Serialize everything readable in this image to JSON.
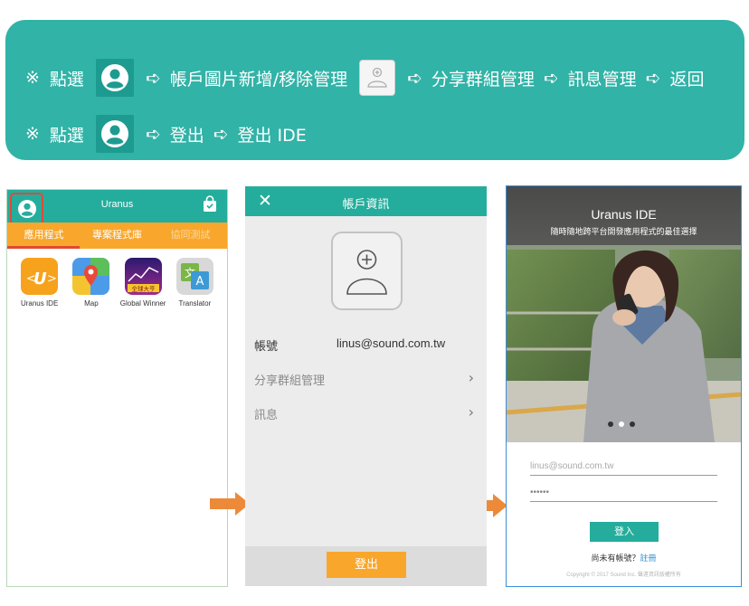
{
  "banner": {
    "row1": {
      "mark": "※",
      "click": "點選",
      "arrow": "➪",
      "step1": "帳戶圖片新增/移除管理",
      "step2": "分享群組管理",
      "step3": "訊息管理",
      "step4": "返回"
    },
    "row2": {
      "mark": "※",
      "click": "點選",
      "arrow": "➪",
      "step1": "登出",
      "step2": "登出 IDE"
    },
    "colors": {
      "background": "#31b3a7",
      "icon_box": "#1e9b90"
    }
  },
  "app_screen": {
    "title": "Uranus",
    "tabs": [
      {
        "label": "應用程式"
      },
      {
        "label": "專案程式庫"
      },
      {
        "label": "協同測試"
      }
    ],
    "apps": [
      {
        "name": "Uranus IDE",
        "icon": "uranus-ide-icon"
      },
      {
        "name": "Map",
        "icon": "map-icon"
      },
      {
        "name": "Global Winner",
        "icon": "global-winner-icon",
        "badge": "全球大亨"
      },
      {
        "name": "Translator",
        "icon": "translator-icon"
      }
    ],
    "colors": {
      "header": "#24ad9c",
      "tabs": "#f8a72c",
      "highlight": "#e04a3a"
    }
  },
  "account_screen": {
    "title": "帳戶資訊",
    "account_label": "帳號",
    "account_value": "linus@sound.com.tw",
    "share_group_label": "分享群組管理",
    "messages_label": "訊息",
    "logout_label": "登出"
  },
  "login_screen": {
    "title": "Uranus IDE",
    "subtitle": "隨時隨地跨平台開發應用程式的最佳選擇",
    "email_placeholder": "linus@sound.com.tw",
    "password_placeholder": "••••••",
    "login_label": "登入",
    "no_account_text": "尚未有帳號？",
    "register_label": "註冊",
    "copyright": "Copyright © 2017 Sound Inc. 聲遠資訊版權所有"
  }
}
